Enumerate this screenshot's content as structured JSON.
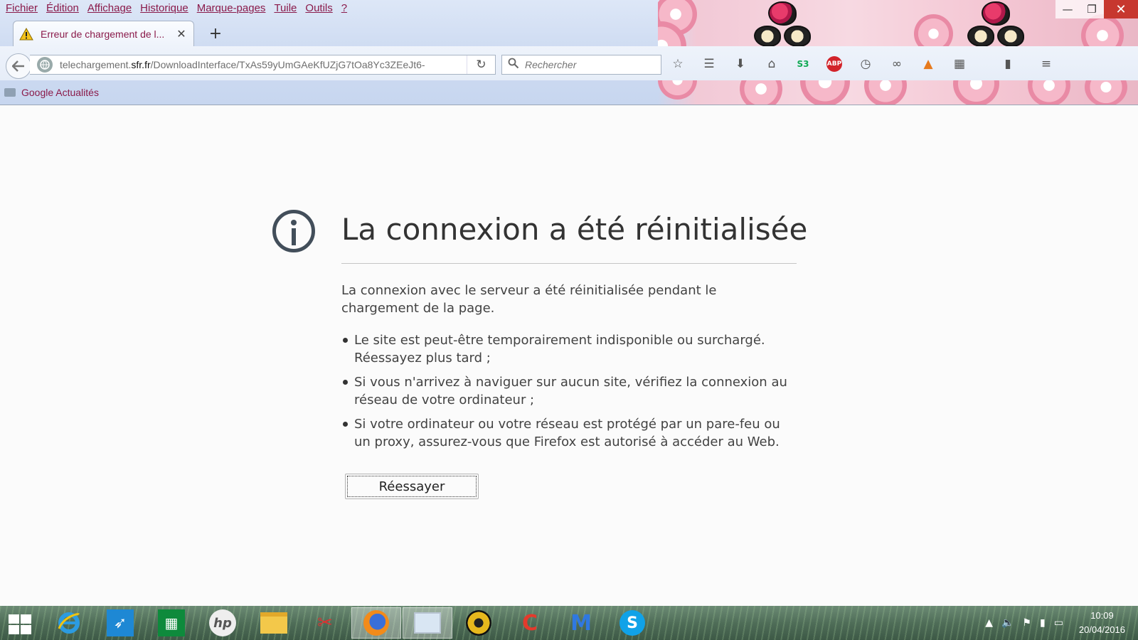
{
  "menubar": [
    "Fichier",
    "Édition",
    "Affichage",
    "Historique",
    "Marque-pages",
    "Tuile",
    "Outils",
    "?"
  ],
  "tab": {
    "title": "Erreur de chargement de l...",
    "close": "✕"
  },
  "newtab": "+",
  "navbar": {
    "url_prefix": "telechargement.",
    "url_domain": "sfr.fr",
    "url_path": "/DownloadInterface/TxAs59yUmGAeKfUZjG7tOa8Yc3ZEeJt6-",
    "search_placeholder": "Rechercher"
  },
  "bookmarks": [
    {
      "label": "Google Actualités"
    }
  ],
  "error": {
    "title": "La connexion a été réinitialisée",
    "description": "La connexion avec le serveur a été réinitialisée pendant le chargement de la page.",
    "items": [
      "Le site est peut-être temporairement indisponible ou surchargé. Réessayez plus tard ;",
      "Si vous n'arrivez à naviguer sur aucun site, vérifiez la connexion au réseau de votre ordinateur ;",
      "Si votre ordinateur ou votre réseau est protégé par un pare-feu ou un proxy, assurez-vous que Firefox est autorisé à accéder au Web."
    ],
    "retry_label": "Réessayer"
  },
  "toolbar_icons": [
    "bookmark-star-icon",
    "reading-list-icon",
    "download-icon",
    "home-icon",
    "s3-addon-icon",
    "adblock-plus-icon",
    "history-icon",
    "mask-icon",
    "fox-addon-icon",
    "grid-icon",
    "clipboard-icon",
    "hamburger-menu-icon"
  ],
  "taskbar": {
    "apps": [
      "internet-explorer",
      "rocket-app",
      "store",
      "hp",
      "file-explorer",
      "snipping-tool",
      "firefox",
      "photo-viewer",
      "music-player",
      "ccleaner",
      "malwarebytes",
      "skype"
    ],
    "time": "10:09",
    "date": "20/04/2016"
  },
  "colors": {
    "menu_text": "#8a1a4a",
    "abp_red": "#d2232a",
    "close_red": "#c7372f"
  }
}
